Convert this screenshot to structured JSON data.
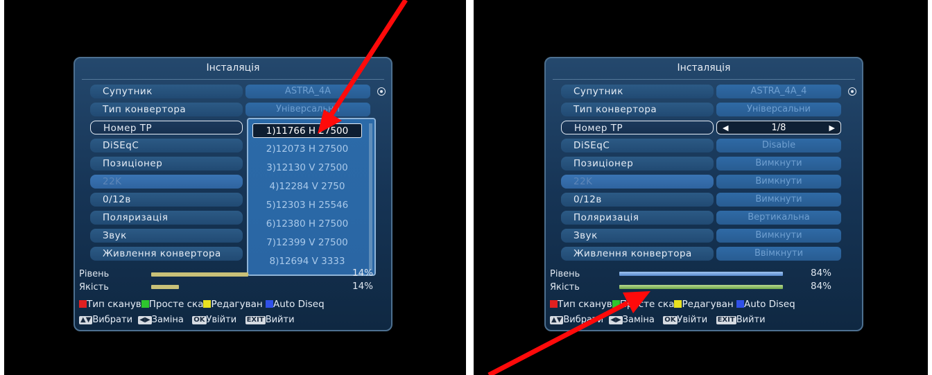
{
  "left": {
    "title": "Інсталяція",
    "rows": [
      {
        "label": "Супутник",
        "value": "ASTRA_4A"
      },
      {
        "label": "Тип конвертора",
        "value": "Універсальни"
      },
      {
        "label": "Номер TP",
        "value": ""
      },
      {
        "label": "DiSEqC",
        "value": ""
      },
      {
        "label": "Позиціонер",
        "value": ""
      },
      {
        "label": "22K",
        "value": ""
      },
      {
        "label": "0/12в",
        "value": ""
      },
      {
        "label": "Поляризація",
        "value": ""
      },
      {
        "label": "Звук",
        "value": ""
      },
      {
        "label": "Живлення конвертора",
        "value": ""
      }
    ],
    "dropdown": [
      "1)11766  H  27500",
      "2)12073  H  27500",
      "3)12130  V  27500",
      "4)12284  V  2750",
      "5)12303  H  25546",
      "6)12380  H  27500",
      "7)12399  V  27500",
      "8)12694  V  3333"
    ],
    "signal": {
      "level_label": "Рівень",
      "quality_label": "Якість",
      "level_pct": "14%",
      "quality_pct": "14%",
      "level_fraction": 0.14,
      "quality_fraction": 0.14
    },
    "legend": [
      "Тип сканув",
      "Просте ска",
      "Редагуван",
      "Auto Diseq"
    ],
    "nav": {
      "select_key": "▲▼",
      "select": "Вибрати",
      "change_key": "◀▶",
      "change": "Заміна",
      "ok_key": "OK",
      "ok": "Увійти",
      "exit_key": "EXIT",
      "exit": "Вийти"
    }
  },
  "right": {
    "title": "Інсталяція",
    "rows": [
      {
        "label": "Супутник",
        "value": "ASTRA_4A_4"
      },
      {
        "label": "Тип конвертора",
        "value": "Універсальни"
      },
      {
        "label": "Номер TP",
        "value": "1/8"
      },
      {
        "label": "DiSEqC",
        "value": "Disable"
      },
      {
        "label": "Позиціонер",
        "value": "Вимкнути"
      },
      {
        "label": "22K",
        "value": "Вимкнути"
      },
      {
        "label": "0/12в",
        "value": "Вимкнути"
      },
      {
        "label": "Поляризація",
        "value": "Вертикальна"
      },
      {
        "label": "Звук",
        "value": "Вимкнути"
      },
      {
        "label": "Живлення конвертора",
        "value": "Ввімкнути"
      }
    ],
    "signal": {
      "level_label": "Рівень",
      "quality_label": "Якість",
      "level_pct": "84%",
      "quality_pct": "84%",
      "level_fraction": 0.84,
      "quality_fraction": 0.84
    },
    "legend": [
      "Тип сканув",
      "Просте ска",
      "Редагуван",
      "Auto Diseq"
    ],
    "nav": {
      "select_key": "▲▼",
      "select": "Вибрати",
      "change_key": "◀▶",
      "change": "Заміна",
      "ok_key": "OK",
      "ok": "Увійти",
      "exit_key": "EXIT",
      "exit": "Вийти"
    }
  },
  "colors": {
    "legend_red": "#e02020",
    "legend_green": "#2ec52e",
    "legend_yellow": "#e8e020",
    "legend_blue": "#3050e8",
    "arrow": "#ff0a0a"
  }
}
